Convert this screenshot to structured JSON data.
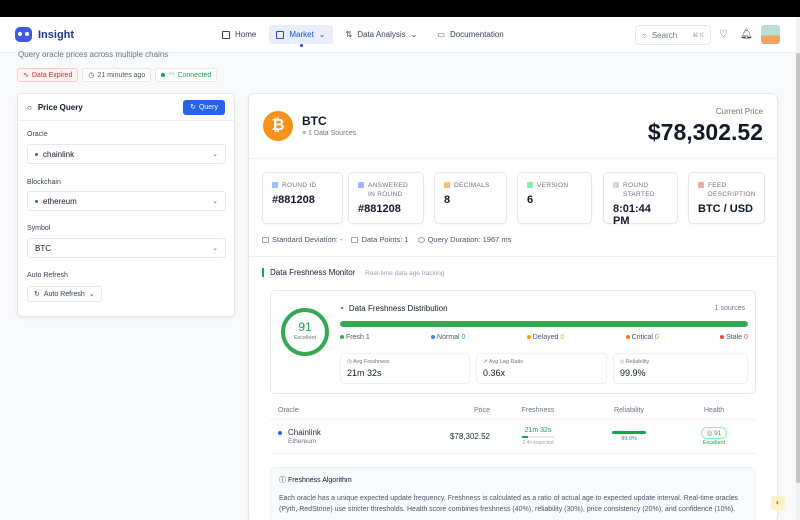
{
  "app": {
    "title": "Insight"
  },
  "nav": {
    "items": [
      {
        "label": "Home",
        "icon": "grid-icon"
      },
      {
        "label": "Market",
        "icon": "chart-icon",
        "active": true
      },
      {
        "label": "Data Analysis",
        "icon": "swap-icon"
      },
      {
        "label": "Documentation",
        "icon": "book-icon"
      }
    ],
    "search": {
      "placeholder": "Search",
      "shortcut": "⌘ K"
    }
  },
  "page": {
    "subtitle": "Query oracle prices across multiple chains",
    "status": {
      "expired": "Data Expired",
      "updated": "21 minutes ago",
      "connection": "Connected"
    }
  },
  "query": {
    "title": "Price Query",
    "button": "Query",
    "oracle_label": "Oracle",
    "oracle_value": "chainlink",
    "chain_label": "Blockchain",
    "chain_value": "ethereum",
    "symbol_label": "Symbol",
    "symbol_value": "BTC",
    "refresh_label": "Auto Refresh",
    "refresh_value": "Auto Refresh"
  },
  "asset": {
    "symbol": "BTC",
    "sources": "1 Data Sources",
    "price_label": "Current Price",
    "price": "$78,302.52"
  },
  "stats": [
    {
      "label": "ROUND ID",
      "value": "#881208",
      "color": "#93c5fd"
    },
    {
      "label": "ANSWERED IN ROUND",
      "value": "#881208",
      "color": "#a5b4fc"
    },
    {
      "label": "DECIMALS",
      "value": "8",
      "color": "#fdba74"
    },
    {
      "label": "VERSION",
      "value": "6",
      "color": "#86efac"
    },
    {
      "label": "ROUND STARTED",
      "value": "8:01:44 PM",
      "color": "#d1d5db"
    },
    {
      "label": "FEED DESCRIPTION",
      "value": "BTC / USD",
      "color": "#fca5a5"
    }
  ],
  "meta": {
    "std_dev": "Standard Deviation: -",
    "points": "Data Points: 1",
    "duration": "Query Duration: 1967 ms"
  },
  "freshness": {
    "title": "Data Freshness Monitor",
    "subtitle": "Real-time data age tracking",
    "score": "91",
    "score_label": "Excellent",
    "dist_title": "Data Freshness Distribution",
    "sources": "1 sources",
    "fresh_fraction": 1.0,
    "legend": [
      {
        "label": "Fresh",
        "count": "1",
        "color": "#34a853"
      },
      {
        "label": "Normal",
        "count": "0",
        "color": "#3b82f6"
      },
      {
        "label": "Delayed",
        "count": "0",
        "color": "#f59e0b"
      },
      {
        "label": "Critical",
        "count": "0",
        "color": "#f97316"
      },
      {
        "label": "Stale",
        "count": "0",
        "color": "#ef4444"
      }
    ],
    "metrics": [
      {
        "label": "Avg Freshness",
        "value": "21m 32s"
      },
      {
        "label": "Avg Lag Ratio",
        "value": "0.36x"
      },
      {
        "label": "Reliability",
        "value": "99.9%"
      }
    ]
  },
  "table": {
    "headers": [
      "Oracle",
      "Price",
      "Freshness",
      "Reliability",
      "Health"
    ],
    "row": {
      "name": "Chainlink",
      "chain": "Ethereum",
      "price": "$78,302.52",
      "freshness": "21m 32s",
      "expected": "2.4x expected",
      "reliability": "99.9%",
      "health": "91",
      "health_label": "Excellent"
    }
  },
  "algorithm": {
    "title": "Freshness Algorithm",
    "text": "Each oracle has a unique expected update frequency. Freshness is calculated as a ratio of actual age to expected update interval. Real-time oracles (Pyth, RedStone) use stricter thresholds. Health score combines freshness (40%), reliability (30%), price consistency (20%), and confidence (10%)."
  }
}
